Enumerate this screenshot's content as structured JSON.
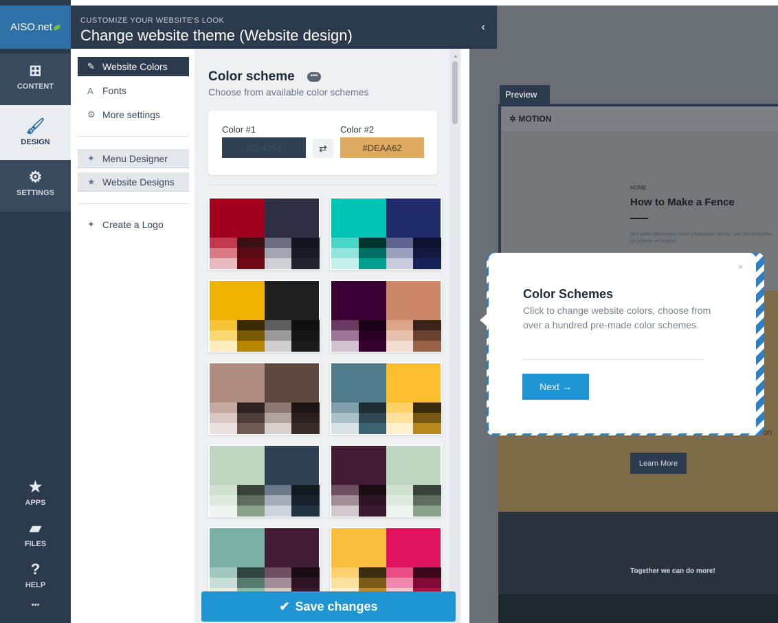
{
  "app": {
    "logo_text": "AISO.net"
  },
  "header": {
    "eyebrow": "CUSTOMIZE YOUR WEBSITE'S LOOK",
    "title": "Change website theme (Website design)",
    "collapse_icon": "‹"
  },
  "rail": {
    "content": {
      "label": "CONTENT",
      "icon": "plus-square-icon",
      "glyph": "⊞"
    },
    "design": {
      "label": "DESIGN",
      "icon": "brush-icon",
      "glyph": "🖌"
    },
    "settings": {
      "label": "SETTINGS",
      "icon": "gears-icon",
      "glyph": "⚙"
    },
    "apps": {
      "label": "APPS",
      "icon": "star-icon",
      "glyph": "★"
    },
    "files": {
      "label": "FILES",
      "icon": "folder-icon",
      "glyph": "▰"
    },
    "help": {
      "label": "HELP",
      "icon": "question-icon",
      "glyph": "?"
    },
    "more": {
      "label": "•••",
      "icon": "more-icon"
    }
  },
  "submenu": {
    "website_colors": {
      "label": "Website Colors",
      "glyph": "✎"
    },
    "fonts": {
      "label": "Fonts",
      "glyph": "A"
    },
    "more_settings": {
      "label": "More settings",
      "glyph": "⚙"
    },
    "menu_designer": {
      "label": "Menu Designer",
      "glyph": "✦"
    },
    "website_designs": {
      "label": "Website Designs",
      "glyph": "★"
    },
    "create_logo": {
      "label": "Create a Logo",
      "glyph": "✦"
    }
  },
  "panel": {
    "title": "Color scheme",
    "badge": "•••",
    "subtitle": "Choose from available color schemes",
    "color1_label": "Color #1",
    "color1_value": "#2e4052",
    "color2_label": "Color #2",
    "color2_value": "#DEAA62",
    "swap_glyph": "⇄"
  },
  "schemes": [
    {
      "a": "#a2001d",
      "b": "#2e2f45",
      "tones": [
        "#c2384c",
        "#3a1015",
        "#6b6d7e",
        "#14141f",
        "#d97a86",
        "#5c0a14",
        "#a3a5b2",
        "#1a1a26",
        "#e8b9bf",
        "#6e0915",
        "#cfd0d6",
        "#22222e"
      ]
    },
    {
      "a": "#00c4b3",
      "b": "#1f2b6b",
      "tones": [
        "#49d6c7",
        "#00352f",
        "#5c648f",
        "#0c1230",
        "#92e5dc",
        "#006e62",
        "#9aa0bd",
        "#141a3f",
        "#c5f2ec",
        "#00a090",
        "#c8cbdb",
        "#18225a"
      ]
    },
    {
      "a": "#efb000",
      "b": "#1f1f1f",
      "tones": [
        "#f5c436",
        "#3a2a00",
        "#5e5e5e",
        "#0f0f0f",
        "#f9d873",
        "#7a5a00",
        "#9a9a9a",
        "#151515",
        "#fdecbd",
        "#b88600",
        "#cfcfcf",
        "#1b1b1b"
      ]
    },
    {
      "a": "#3a0033",
      "b": "#cc8866",
      "tones": [
        "#6b3a63",
        "#1a0017",
        "#dba58a",
        "#3a2419",
        "#9d7495",
        "#2a0025",
        "#e8c1ad",
        "#6b4230",
        "#d4c2d1",
        "#38002f",
        "#f2dccf",
        "#9a6247"
      ]
    },
    {
      "a": "#b08b80",
      "b": "#5e4840",
      "tones": [
        "#c5aaa2",
        "#2e2320",
        "#8d7770",
        "#1c1513",
        "#d8c7c2",
        "#4d3c37",
        "#b3a49e",
        "#2b201d",
        "#ebe2df",
        "#6e5a53",
        "#d9d1ce",
        "#3a2d29"
      ]
    },
    {
      "a": "#507c8c",
      "b": "#fbbf2f",
      "tones": [
        "#7e9fab",
        "#1c2c32",
        "#fdd068",
        "#3a2c0a",
        "#acc2ca",
        "#2d4852",
        "#fde19d",
        "#755914",
        "#d8e3e7",
        "#3d6272",
        "#fef0cc",
        "#b88a1e"
      ]
    },
    {
      "a": "#bed6bf",
      "b": "#2e4052",
      "tones": [
        "#cfe1cf",
        "#3a433a",
        "#6b7a89",
        "#101820",
        "#dfeadf",
        "#5e6d5e",
        "#a3aeb9",
        "#18222d",
        "#eef4ee",
        "#8aa38a",
        "#cdd3da",
        "#223243"
      ]
    },
    {
      "a": "#421c33",
      "b": "#bed6bf",
      "tones": [
        "#6e4e61",
        "#1a0b14",
        "#cfe1cf",
        "#3a433a",
        "#a08d98",
        "#2e1324",
        "#dfeadf",
        "#5e6d5e",
        "#d2c8ce",
        "#3a1a2e",
        "#eef4ee",
        "#8aa38a"
      ]
    },
    {
      "a": "#7ab0a5",
      "b": "#421c33",
      "tones": [
        "#a1c8bf",
        "#2f4540",
        "#6e4e61",
        "#1a0b14",
        "#c7ddd8",
        "#547a72",
        "#a08d98",
        "#2e1324",
        "#e3efec",
        "#8abbb0",
        "#d2c8ce",
        "#3a1a2e"
      ]
    },
    {
      "a": "#fbbf3f",
      "b": "#e0115f",
      "tones": [
        "#fcd06f",
        "#3a2c0e",
        "#e84c85",
        "#3d0519",
        "#fde19f",
        "#7a5c1a",
        "#f088ae",
        "#800a37",
        "#fef0cf",
        "#b88a2c",
        "#f7c3d6",
        "#b00d4b"
      ]
    }
  ],
  "save": {
    "label": "Save changes",
    "glyph": "✔"
  },
  "preview": {
    "tab": "Preview",
    "brand": "✲ MOTION",
    "home": "HOME",
    "heading": "How to Make a Fence",
    "body": "Sed pede ullamcorper amet ullamcorper primis, nam pro phasellus sit pulvinar vel integer.",
    "behind_text": "on",
    "button": "Learn More",
    "footer": "Together we can do more!"
  },
  "tooltip": {
    "close": "×",
    "title": "Color Schemes",
    "text": "Click to change website colors, choose from over a hundred pre-made color schemes.",
    "next": "Next →"
  },
  "colors": {
    "accent": "#1f95d3",
    "navy": "#2b3a4d",
    "highlight": "#2f7fc4"
  }
}
